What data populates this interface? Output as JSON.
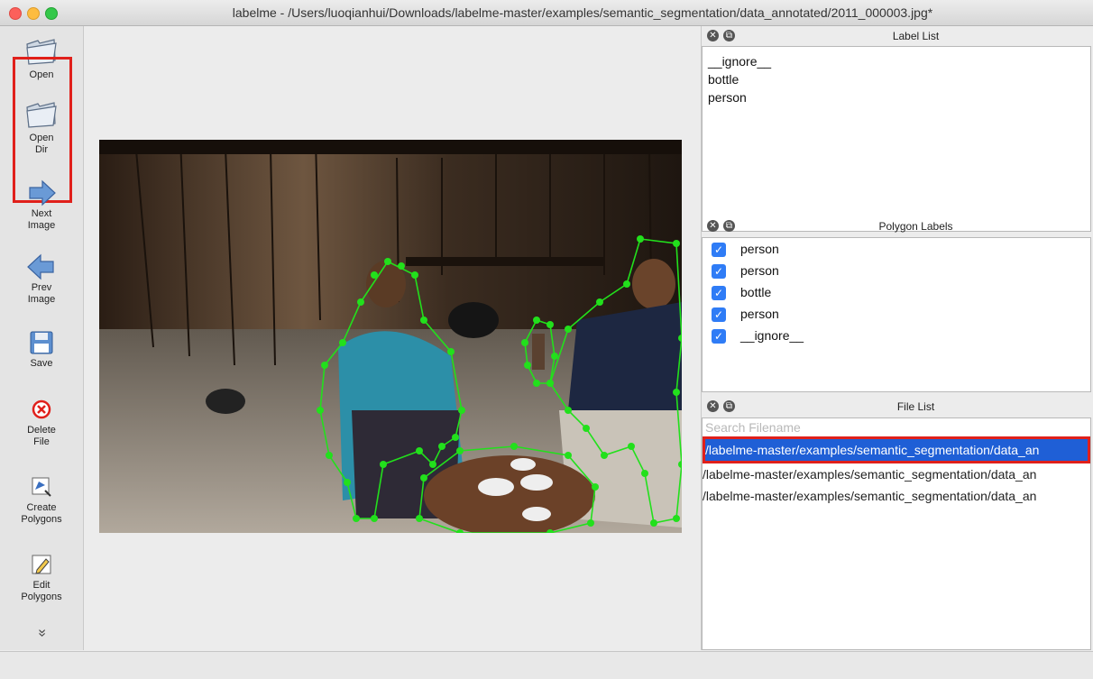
{
  "window": {
    "title": "labelme - /Users/luoqianhui/Downloads/labelme-master/examples/semantic_segmentation/data_annotated/2011_000003.jpg*"
  },
  "toolbar": {
    "open": "Open",
    "open_dir": "Open\nDir",
    "next_image": "Next\nImage",
    "prev_image": "Prev\nImage",
    "save": "Save",
    "delete_file": "Delete\nFile",
    "create_polygons": "Create\nPolygons",
    "edit_polygons": "Edit\nPolygons",
    "more": "»"
  },
  "label_list": {
    "title": "Label List",
    "items": [
      "__ignore__",
      "bottle",
      "person"
    ]
  },
  "polygon_labels": {
    "title": "Polygon Labels",
    "items": [
      {
        "label": "person",
        "checked": true
      },
      {
        "label": "person",
        "checked": true
      },
      {
        "label": "bottle",
        "checked": true
      },
      {
        "label": "person",
        "checked": true
      },
      {
        "label": "__ignore__",
        "checked": true
      }
    ]
  },
  "file_list": {
    "title": "File List",
    "search_placeholder": "Search Filename",
    "items": [
      "/labelme-master/examples/semantic_segmentation/data_an",
      "/labelme-master/examples/semantic_segmentation/data_an",
      "/labelme-master/examples/semantic_segmentation/data_an"
    ],
    "selected_index": 0
  },
  "colors": {
    "accent": "#1f5fd6",
    "highlight": "#e0201b",
    "polygon": "#22e01c"
  }
}
